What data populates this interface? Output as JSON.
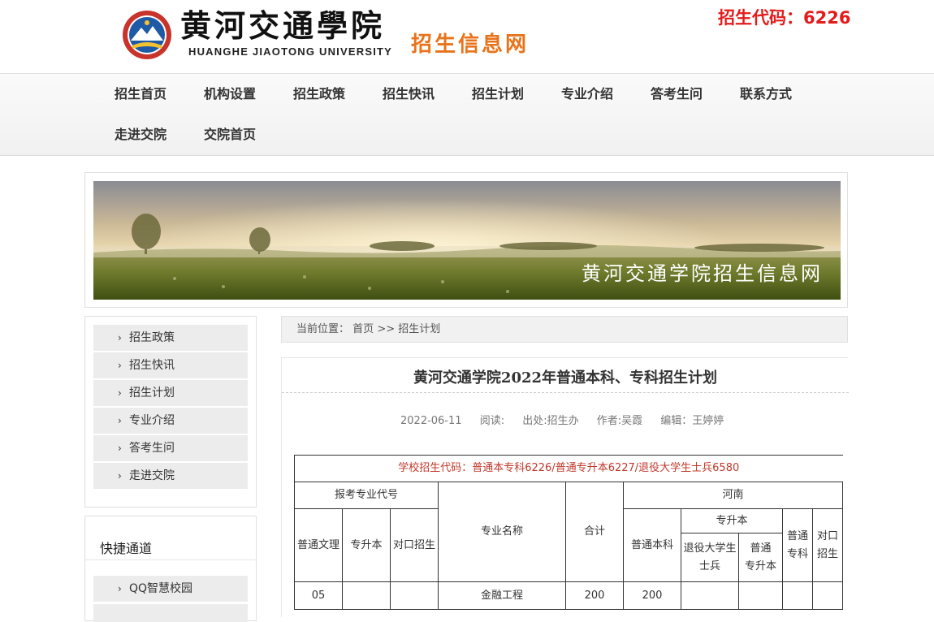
{
  "header": {
    "logo_cn": "黄河交通學院",
    "logo_en": "HUANGHE JIAOTONG UNIVERSITY",
    "site_name": "招生信息网",
    "enroll_code": "招生代码：6226"
  },
  "nav": {
    "items": [
      "招生首页",
      "机构设置",
      "招生政策",
      "招生快讯",
      "招生计划",
      "专业介绍",
      "答考生问",
      "联系方式",
      "走进交院",
      "交院首页"
    ]
  },
  "banner": {
    "caption": "黄河交通学院招生信息网"
  },
  "sidebar": {
    "items": [
      "招生政策",
      "招生快讯",
      "招生计划",
      "专业介绍",
      "答考生问",
      "走进交院"
    ],
    "quick_title": "快捷通道",
    "quick_items": [
      "QQ智慧校园"
    ]
  },
  "breadcrumb": {
    "label": "当前位置：",
    "home": "首页",
    "sep": ">>",
    "current": "招生计划"
  },
  "article": {
    "title": "黄河交通学院2022年普通本科、专科招生计划",
    "date": "2022-06-11",
    "reads": "阅读:",
    "source": "出处:招生办",
    "author": "作者:吴霞",
    "editor": "编辑：王婷婷"
  },
  "table": {
    "caption": "学校招生代码：普通本专科6226/普通专升本6227/退役大学生士兵6580",
    "h_code": "报考专业代号",
    "h_regular": "普通文理",
    "h_upgrade": "专升本",
    "h_duikou": "对口招生",
    "h_major": "专业名称",
    "h_total": "合计",
    "h_henan": "河南",
    "h_bk": "普通本科",
    "h_zsb": "专升本",
    "h_veteran": "退役大学生士兵",
    "h_pt_zsb": "普通　专升本",
    "h_pt_zk": "普通专科",
    "h_dk2": "对口招生",
    "row1": {
      "code": "05",
      "major": "金融工程",
      "total": "200",
      "bk": "200"
    }
  },
  "colors": {
    "accent": "#e8731a",
    "code_red": "#e31b1b",
    "caption_red": "#c0392b"
  }
}
